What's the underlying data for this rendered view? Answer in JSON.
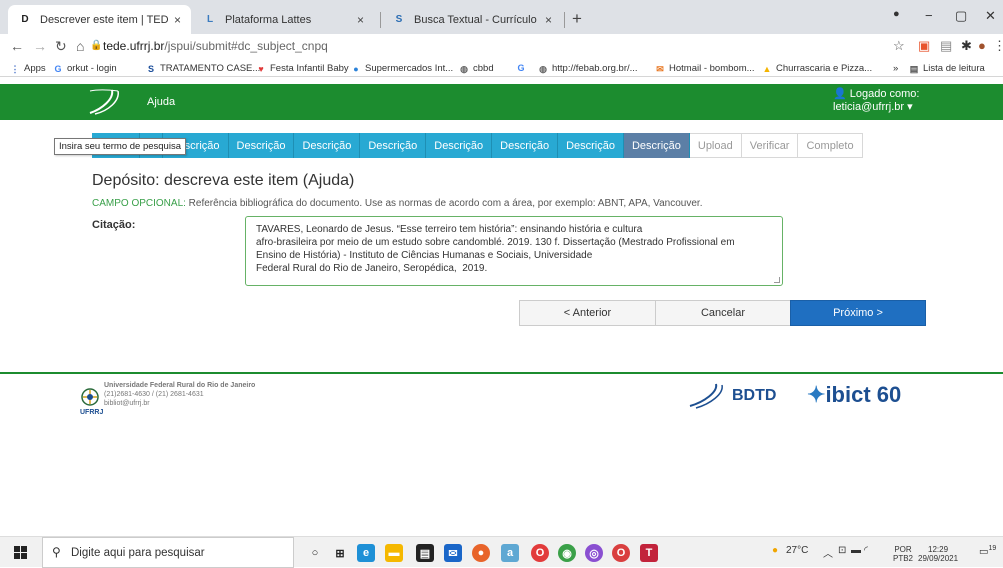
{
  "tabs": [
    {
      "title": "Descrever este item | TEDE",
      "icon": "D",
      "close": "×"
    },
    {
      "title": "Plataforma Lattes",
      "icon": "L",
      "close": "×"
    },
    {
      "title": "Busca Textual - Currículo Lattes",
      "icon": "S",
      "close": "×"
    }
  ],
  "new_tab": "+",
  "window": {
    "minimize": "−",
    "restore": "▢",
    "close": "✕"
  },
  "address": {
    "host": "tede.ufrrj.br",
    "path": "/jspui/submit#dc_subject_cnpq"
  },
  "bookmarks": [
    {
      "label": "Apps",
      "icon": "apps-icon"
    },
    {
      "label": "orkut - login",
      "icon": "google-icon"
    },
    {
      "label": "TRATAMENTO CASE...",
      "icon": "s-icon"
    },
    {
      "label": "Festa Infantil Baby",
      "icon": "heart-icon"
    },
    {
      "label": "Supermercados Int...",
      "icon": "globe-icon"
    },
    {
      "label": "cbbd",
      "icon": "globe-icon"
    },
    {
      "label": "",
      "icon": "google-icon"
    },
    {
      "label": "http://febab.org.br/...",
      "icon": "globe-icon"
    },
    {
      "label": "Hotmail - bombom...",
      "icon": "mail-icon"
    },
    {
      "label": "Churrascaria e Pizza...",
      "icon": "drive-icon"
    }
  ],
  "bookmarks_more": "»",
  "reading_list": "Lista de leitura",
  "header": {
    "help": "Ajuda",
    "logged_as": "Logado como:",
    "user": "leticia@ufrrj.br ▾"
  },
  "tooltip": "Insira seu termo de pesquisa",
  "steps": [
    {
      "label": "Descrição",
      "state": "done",
      "visible_label": "ça"
    },
    {
      "label": "Descrição",
      "state": "done"
    },
    {
      "label": "Descrição",
      "state": "done"
    },
    {
      "label": "Descrição",
      "state": "done"
    },
    {
      "label": "Descrição",
      "state": "done"
    },
    {
      "label": "Descrição",
      "state": "done"
    },
    {
      "label": "Descrição",
      "state": "done"
    },
    {
      "label": "Descrição",
      "state": "done"
    },
    {
      "label": "Descrição",
      "state": "current"
    },
    {
      "label": "Upload",
      "state": "disabled"
    },
    {
      "label": "Verificar",
      "state": "disabled"
    },
    {
      "label": "Completo",
      "state": "disabled"
    }
  ],
  "page_title": "Depósito: descreva este item (Ajuda)",
  "hint": {
    "optional": "CAMPO OPCIONAL:",
    "text": " Referência bibliográfica do documento. Use as normas de acordo com a área, por exemplo: ABNT, APA, Vancouver."
  },
  "field_label": "Citação:",
  "citation": "TAVARES, Leonardo de Jesus. “Esse terreiro tem história”: ensinando história e cultura\nafro-brasileira por meio de um estudo sobre candomblé. 2019. 130 f. Dissertação (Mestrado Profissional em\nEnsino de História) - Instituto de Ciências Humanas e Sociais, Universidade\nFederal Rural do Rio de Janeiro, Seropédica,  2019.",
  "buttons": {
    "previous": "< Anterior",
    "cancel": "Cancelar",
    "next": "Próximo >"
  },
  "footer": {
    "university": "Universidade Federal Rural do Rio de Janeiro",
    "phone": "(21)2681-4630 / (21) 2681-4631",
    "email": "bibliot@ufrrj.br",
    "acronym": "UFRRJ",
    "bdtd": "BDTD",
    "ibict": "ibict 60"
  },
  "taskbar": {
    "search_placeholder": "Digite aqui para pesquisar",
    "weather": "27°C",
    "lang1": "POR",
    "lang2": "PTB2",
    "time": "12:29",
    "date": "29/09/2021",
    "notifications": "19"
  },
  "colors": {
    "header_green": "#1c8c2f",
    "step_blue": "#28a9d3",
    "step_current": "#5c7fa6",
    "primary_button": "#1f6fc1"
  }
}
